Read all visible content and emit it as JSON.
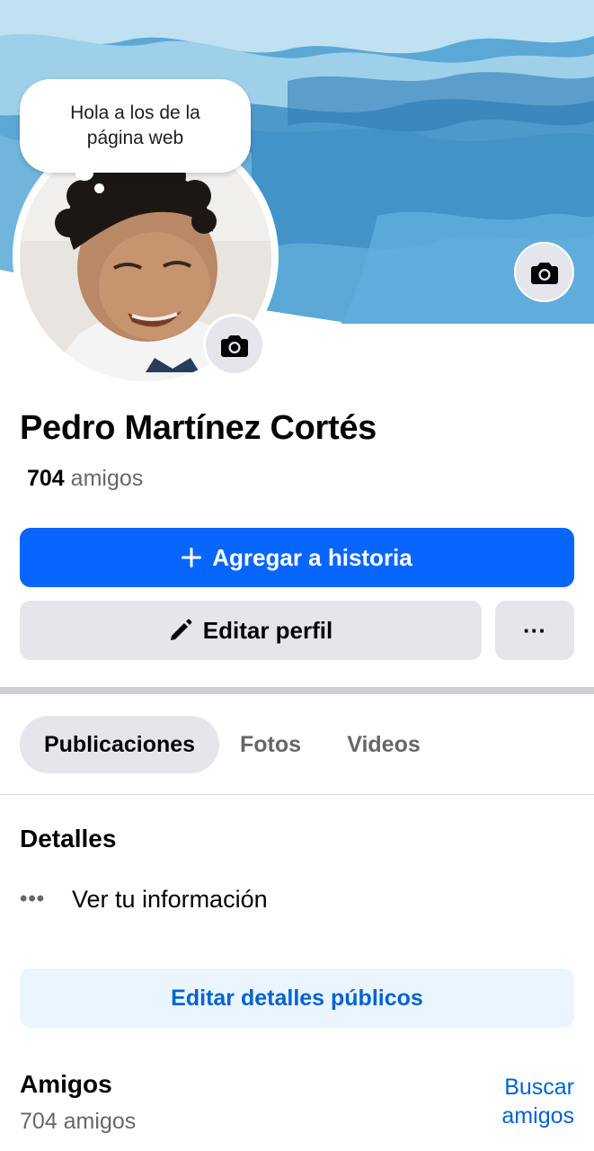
{
  "profile": {
    "note": "Hola a los de la página web",
    "name": "Pedro Martínez Cortés",
    "friends_number": "704",
    "friends_word": "amigos"
  },
  "actions": {
    "add_story": "Agregar a historia",
    "edit_profile": "Editar perfil",
    "more": "···"
  },
  "tabs": [
    {
      "label": "Publicaciones",
      "active": true
    },
    {
      "label": "Fotos",
      "active": false
    },
    {
      "label": "Videos",
      "active": false
    }
  ],
  "details": {
    "title": "Detalles",
    "row_label": "Ver tu información",
    "row_icon": "more-dots-icon",
    "edit_public_label": "Editar detalles públicos"
  },
  "friends": {
    "title": "Amigos",
    "count_label": "704 amigos",
    "find_label": "Buscar amigos"
  },
  "icons": {
    "cover_camera": "camera-icon",
    "avatar_camera": "camera-icon",
    "story": "plus-icon",
    "edit": "pencil-icon"
  },
  "colors": {
    "primary": "#0866ff",
    "link": "#0064d1",
    "secondary_bg": "#e4e6eb",
    "secondary_text": "#65676b",
    "soft_blue_bg": "#ebf5ff"
  }
}
